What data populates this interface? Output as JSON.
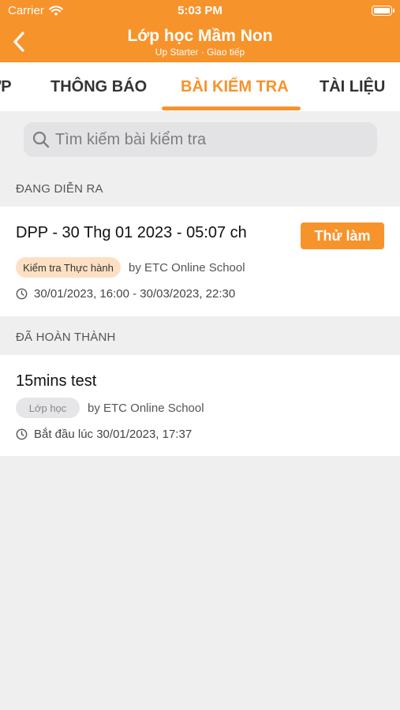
{
  "status_bar": {
    "carrier": "Carrier",
    "time": "5:03 PM"
  },
  "header": {
    "title": "Lớp học Mầm Non",
    "subtitle": "Up Starter · Giao tiếp"
  },
  "tabs": [
    {
      "label": "LỚP"
    },
    {
      "label": "THÔNG BÁO"
    },
    {
      "label": "BÀI KIỂM TRA",
      "active": true
    },
    {
      "label": "TÀI LIỆU"
    }
  ],
  "search": {
    "placeholder": "Tìm kiếm bài kiểm tra"
  },
  "sections": {
    "ongoing": {
      "label": "ĐANG DIỄN RA",
      "item": {
        "title": "DPP - 30 Thg 01 2023 - 05:07 ch",
        "action": "Thử làm",
        "badge": "Kiểm tra Thực hành",
        "by": "by ETC Online School",
        "time": "30/01/2023, 16:00 - 30/03/2023, 22:30"
      }
    },
    "completed": {
      "label": "ĐÃ HOÀN THÀNH",
      "item": {
        "title": "15mins test",
        "badge": "Lớp học",
        "by": "by ETC Online School",
        "time": "Bắt đầu lúc 30/01/2023, 17:37"
      }
    }
  },
  "colors": {
    "accent": "#f7932b",
    "background": "#efeff0"
  },
  "icons": [
    "wifi-icon",
    "battery-icon",
    "back-chevron-icon",
    "search-icon",
    "clock-icon"
  ]
}
